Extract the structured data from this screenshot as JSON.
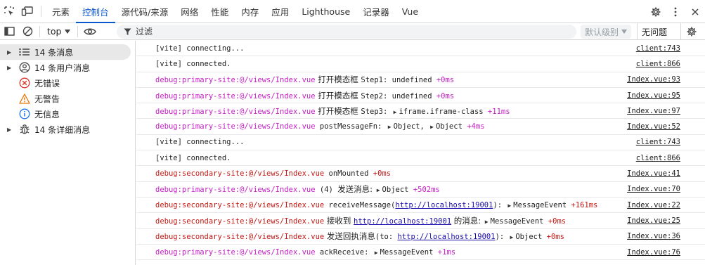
{
  "tabs": [
    "元素",
    "控制台",
    "源代码/来源",
    "网络",
    "性能",
    "内存",
    "应用",
    "Lighthouse",
    "记录器",
    "Vue"
  ],
  "active_tab": "控制台",
  "toolbar": {
    "context": "top",
    "filter_placeholder": "过滤",
    "levels": "默认级别",
    "issues": "无问题"
  },
  "sidebar": {
    "items": [
      {
        "label": "14 条消息",
        "icon": "list-icon",
        "expandable": true,
        "selected": true
      },
      {
        "label": "14 条用户消息",
        "icon": "user-icon",
        "expandable": true,
        "selected": false
      },
      {
        "label": "无错误",
        "icon": "error-icon",
        "expandable": false,
        "selected": false
      },
      {
        "label": "无警告",
        "icon": "warning-icon",
        "expandable": false,
        "selected": false
      },
      {
        "label": "无信息",
        "icon": "info-icon",
        "expandable": false,
        "selected": false
      },
      {
        "label": "14 条详细消息",
        "icon": "bug-icon",
        "expandable": true,
        "selected": false
      }
    ]
  },
  "colors": {
    "accent": "#0b57d0",
    "primary_ns": "#c51ec5",
    "secondary_ns": "#c41a16",
    "timing_primary": "#c51ec5",
    "timing_secondary": "#c41a16"
  },
  "messages": [
    {
      "parts": [
        {
          "t": "text",
          "v": "[vite] connecting..."
        }
      ],
      "source": "client:743"
    },
    {
      "parts": [
        {
          "t": "text",
          "v": "[vite] connected."
        }
      ],
      "source": "client:866"
    },
    {
      "parts": [
        {
          "t": "ns",
          "v": "debug:primary-site:@/views/Index.vue",
          "c": "primary"
        },
        {
          "t": "cn",
          "v": " 打开模态框 "
        },
        {
          "t": "text",
          "v": "Step1: undefined "
        },
        {
          "t": "timing",
          "v": "+0ms",
          "c": "primary"
        }
      ],
      "source": "Index.vue:93"
    },
    {
      "parts": [
        {
          "t": "ns",
          "v": "debug:primary-site:@/views/Index.vue",
          "c": "primary"
        },
        {
          "t": "cn",
          "v": " 打开模态框 "
        },
        {
          "t": "text",
          "v": "Step2: undefined "
        },
        {
          "t": "timing",
          "v": "+0ms",
          "c": "primary"
        }
      ],
      "source": "Index.vue:95"
    },
    {
      "parts": [
        {
          "t": "ns",
          "v": "debug:primary-site:@/views/Index.vue",
          "c": "primary"
        },
        {
          "t": "cn",
          "v": " 打开模态框 "
        },
        {
          "t": "text",
          "v": "Step3: "
        },
        {
          "t": "obj",
          "v": "iframe.iframe-class "
        },
        {
          "t": "timing",
          "v": "+11ms",
          "c": "primary"
        }
      ],
      "source": "Index.vue:97"
    },
    {
      "parts": [
        {
          "t": "ns",
          "v": "debug:primary-site:@/views/Index.vue",
          "c": "primary"
        },
        {
          "t": "text",
          "v": " postMessageFn: "
        },
        {
          "t": "obj",
          "v": "Object, "
        },
        {
          "t": "obj",
          "v": "Object "
        },
        {
          "t": "timing",
          "v": "+4ms",
          "c": "primary"
        }
      ],
      "source": "Index.vue:52"
    },
    {
      "parts": [
        {
          "t": "text",
          "v": "[vite] connecting..."
        }
      ],
      "source": "client:743"
    },
    {
      "parts": [
        {
          "t": "text",
          "v": "[vite] connected."
        }
      ],
      "source": "client:866"
    },
    {
      "parts": [
        {
          "t": "ns",
          "v": "debug:secondary-site:@/views/Index.vue",
          "c": "secondary"
        },
        {
          "t": "text",
          "v": " onMounted "
        },
        {
          "t": "timing",
          "v": "+0ms",
          "c": "secondary"
        }
      ],
      "source": "Index.vue:41"
    },
    {
      "parts": [
        {
          "t": "ns",
          "v": "debug:primary-site:@/views/Index.vue",
          "c": "primary"
        },
        {
          "t": "text",
          "v": " (4) "
        },
        {
          "t": "cn",
          "v": "发送消息: "
        },
        {
          "t": "obj",
          "v": "Object "
        },
        {
          "t": "timing",
          "v": "+502ms",
          "c": "primary"
        }
      ],
      "source": "Index.vue:70"
    },
    {
      "parts": [
        {
          "t": "ns",
          "v": "debug:secondary-site:@/views/Index.vue",
          "c": "secondary"
        },
        {
          "t": "text",
          "v": " receiveMessage("
        },
        {
          "t": "url",
          "v": "http://localhost:19001"
        },
        {
          "t": "text",
          "v": "): "
        },
        {
          "t": "obj",
          "v": "MessageEvent "
        },
        {
          "t": "timing",
          "v": "+161ms",
          "c": "secondary"
        }
      ],
      "source": "Index.vue:22"
    },
    {
      "parts": [
        {
          "t": "ns",
          "v": "debug:secondary-site:@/views/Index.vue",
          "c": "secondary"
        },
        {
          "t": "cn",
          "v": " 接收到 "
        },
        {
          "t": "url",
          "v": "http://localhost:19001"
        },
        {
          "t": "cn",
          "v": " 的消息: "
        },
        {
          "t": "obj",
          "v": "MessageEvent "
        },
        {
          "t": "timing",
          "v": "+0ms",
          "c": "secondary"
        }
      ],
      "source": "Index.vue:25"
    },
    {
      "parts": [
        {
          "t": "ns",
          "v": "debug:secondary-site:@/views/Index.vue",
          "c": "secondary"
        },
        {
          "t": "cn",
          "v": " 发送回执消息"
        },
        {
          "t": "text",
          "v": "(to: "
        },
        {
          "t": "url",
          "v": "http://localhost:19001"
        },
        {
          "t": "text",
          "v": "): "
        },
        {
          "t": "obj",
          "v": "Object "
        },
        {
          "t": "timing",
          "v": "+0ms",
          "c": "secondary"
        }
      ],
      "source": "Index.vue:36"
    },
    {
      "parts": [
        {
          "t": "ns",
          "v": "debug:primary-site:@/views/Index.vue",
          "c": "primary"
        },
        {
          "t": "text",
          "v": " ackReceive: "
        },
        {
          "t": "obj",
          "v": "MessageEvent "
        },
        {
          "t": "timing",
          "v": "+1ms",
          "c": "primary"
        }
      ],
      "source": "Index.vue:76"
    }
  ]
}
